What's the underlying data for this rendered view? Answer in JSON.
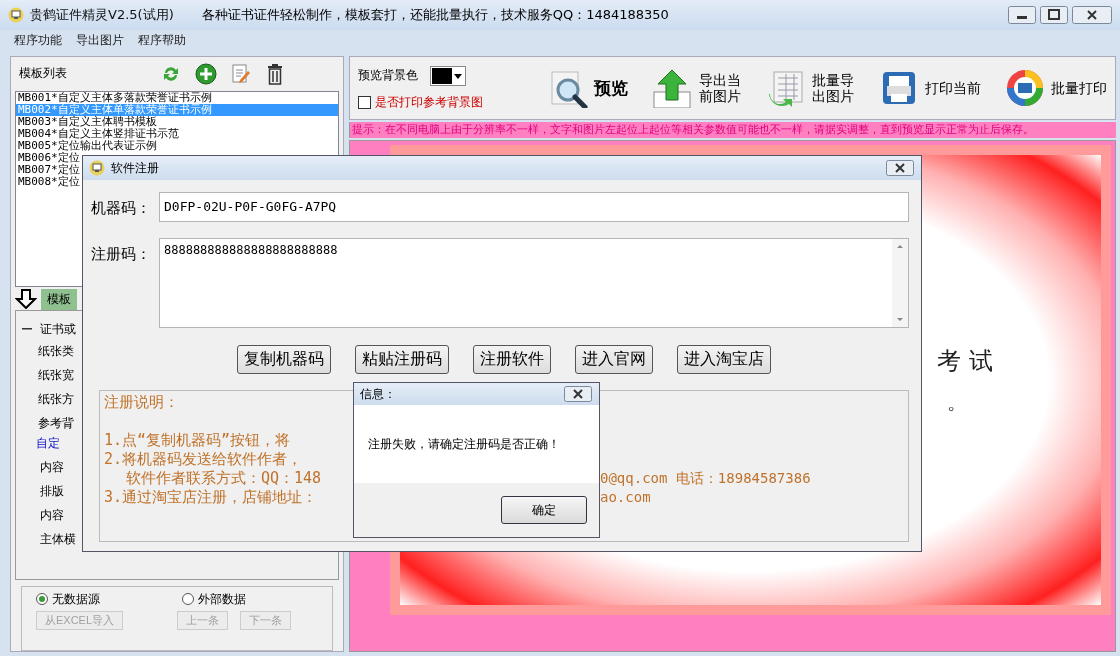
{
  "window": {
    "title": "贵鹤证件精灵V2.5(试用)",
    "tagline": "各种证书证件轻松制作，模板套打，还能批量执行，技术服务QQ：1484188350"
  },
  "menu": [
    "程序功能",
    "导出图片",
    "程序帮助"
  ],
  "template_panel": {
    "title": "模板列表",
    "items": [
      {
        "label": "MB001*自定义主体多落款荣誉证书示例",
        "selected": false
      },
      {
        "label": "MB002*自定义主体单落款荣誉证书示例",
        "selected": true
      },
      {
        "label": "MB003*自定义主体聘书模板",
        "selected": false
      },
      {
        "label": "MB004*自定义主体竖排证书示范",
        "selected": false
      },
      {
        "label": "MB005*定位输出代表证示例",
        "selected": false
      },
      {
        "label": "MB006*定位",
        "selected": false
      },
      {
        "label": "MB007*定位",
        "selected": false
      },
      {
        "label": "MB008*定位",
        "selected": false
      }
    ]
  },
  "settings_panel": {
    "tab": "模板",
    "group": "证书或",
    "labels": [
      "纸张类",
      "纸张宽",
      "纸张方",
      "参考背"
    ],
    "subgroup": "自定",
    "sublabels": [
      "内容",
      "排版",
      "内容",
      "主体横"
    ]
  },
  "data_source": {
    "options": [
      {
        "label": "无数据源",
        "selected": true
      },
      {
        "label": "外部数据",
        "selected": false
      }
    ],
    "buttons": [
      {
        "label": "从EXCEL导入",
        "disabled": true
      },
      {
        "label": "上一条",
        "disabled": true
      },
      {
        "label": "下一条",
        "disabled": true
      }
    ]
  },
  "preview_bar": {
    "bg_label": "预览背景色",
    "print_bg": {
      "label": "是否打印参考背景图",
      "checked": false
    }
  },
  "tools": [
    {
      "kind": "preview",
      "label": "预览"
    },
    {
      "kind": "export",
      "label": "导出当前图片"
    },
    {
      "kind": "batch_export",
      "label": "批量导出图片"
    },
    {
      "kind": "print",
      "label": "打印当前"
    },
    {
      "kind": "batch_print",
      "label": "批量打印"
    }
  ],
  "tip": "提示：在不同电脑上由于分辨率不一样，文字和图片左起位上起位等相关参数值可能也不一样，请据实调整，直到预览显示正常为止后保存。",
  "certificate": {
    "heading": "考 试",
    "note": "。"
  },
  "registration": {
    "title": "软件注册",
    "machine_label": "机器码：",
    "machine_code": "D0FP-02U-P0F-G0FG-A7PQ",
    "reg_label": "注册码：",
    "reg_code": "888888888888888888888888",
    "buttons": [
      "复制机器码",
      "粘贴注册码",
      "注册软件",
      "进入官网",
      "进入淘宝店"
    ],
    "instructions": {
      "heading": "注册说明：",
      "lines": [
        {
          "kind": "item",
          "left": "1.点“复制机器码”按钮，将"
        },
        {
          "kind": "item",
          "left": "2.将机器码发送给软件作者，"
        },
        {
          "kind": "continuation",
          "left": "软件作者联系方式：QQ：148",
          "right": "0@qq.com  电话：18984587386"
        },
        {
          "kind": "item",
          "left": "3.通过淘宝店注册，店铺地址：",
          "right": "ao.com"
        }
      ]
    }
  },
  "message": {
    "title": "信息：",
    "text": "注册失败，请确定注册码是否正确！",
    "button": "确定"
  }
}
